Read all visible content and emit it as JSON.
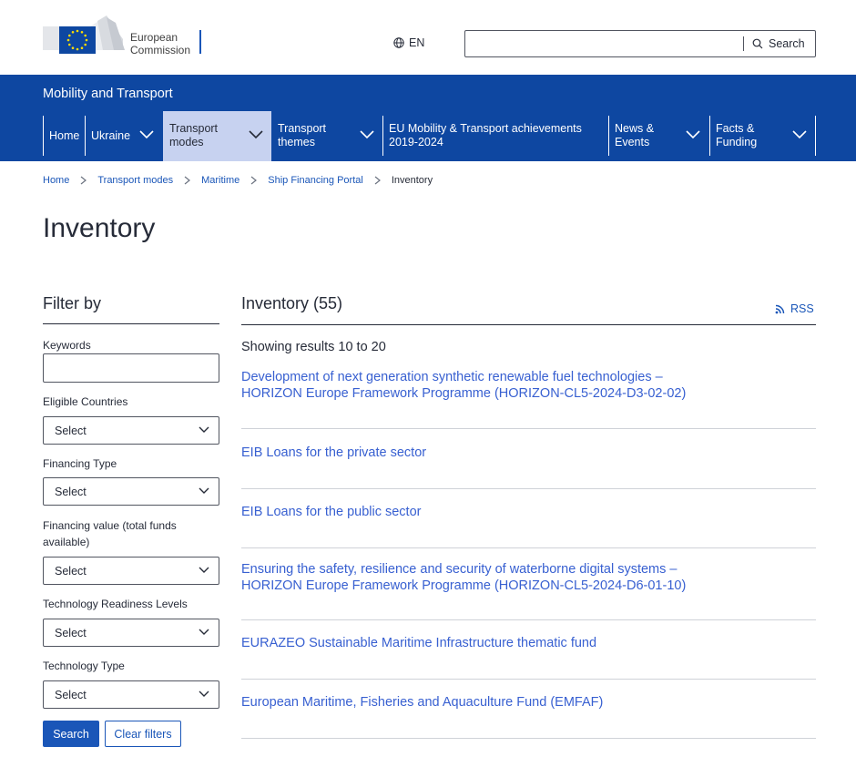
{
  "header": {
    "logo_line1": "European",
    "logo_line2": "Commission",
    "language": "EN",
    "language_icon": "globe-icon",
    "search_placeholder": "",
    "search_label": "Search",
    "search_icon": "magnifier-icon"
  },
  "site": {
    "name": "Mobility and Transport"
  },
  "nav": {
    "items": [
      {
        "label": "Home",
        "has_dropdown": false,
        "active": false
      },
      {
        "label": "Ukraine",
        "has_dropdown": true,
        "active": false
      },
      {
        "label": "Transport modes",
        "has_dropdown": true,
        "active": true
      },
      {
        "label": "Transport themes",
        "has_dropdown": true,
        "active": false
      },
      {
        "label": "EU Mobility & Transport achievements 2019-2024",
        "has_dropdown": false,
        "active": false
      },
      {
        "label": "News & Events",
        "has_dropdown": true,
        "active": false
      },
      {
        "label": "Facts & Funding",
        "has_dropdown": true,
        "active": false
      }
    ]
  },
  "breadcrumb": {
    "items": [
      "Home",
      "Transport modes",
      "Maritime",
      "Ship Financing Portal"
    ],
    "current": "Inventory"
  },
  "page": {
    "title": "Inventory"
  },
  "filters": {
    "title": "Filter by",
    "keywords_label": "Keywords",
    "keywords_value": "",
    "selects": [
      {
        "label": "Eligible Countries",
        "value": "Select"
      },
      {
        "label": "Financing Type",
        "value": "Select"
      },
      {
        "label": "Financing value (total funds available)",
        "value": "Select"
      },
      {
        "label": "Technology Readiness Levels",
        "value": "Select"
      },
      {
        "label": "Technology Type",
        "value": "Select"
      }
    ],
    "search_button": "Search",
    "clear_button": "Clear filters"
  },
  "results": {
    "title": "Inventory (55)",
    "rss_label": "RSS",
    "rss_icon": "rss-icon",
    "showing": "Showing results 10 to 20",
    "items": [
      {
        "line1": "Development of next generation synthetic renewable fuel technologies –",
        "line2": "HORIZON Europe Framework Programme (HORIZON-CL5-2024-D3-02-02)"
      },
      {
        "line1": "EIB Loans for the private sector",
        "line2": ""
      },
      {
        "line1": "EIB Loans for the public sector",
        "line2": ""
      },
      {
        "line1": "Ensuring the safety, resilience and security of waterborne digital systems –",
        "line2": "HORIZON Europe Framework Programme (HORIZON-CL5-2024-D6-01-10)"
      },
      {
        "line1": "EURAZEO Sustainable Maritime Infrastructure thematic fund",
        "line2": ""
      },
      {
        "line1": "European Maritime, Fisheries and Aquaculture Fund (EMFAF)",
        "line2": ""
      }
    ]
  },
  "colors": {
    "band": "#0e47a1",
    "nav_active": "#c7d2f0",
    "link": "#3860d1",
    "primary": "#1a56b8"
  }
}
